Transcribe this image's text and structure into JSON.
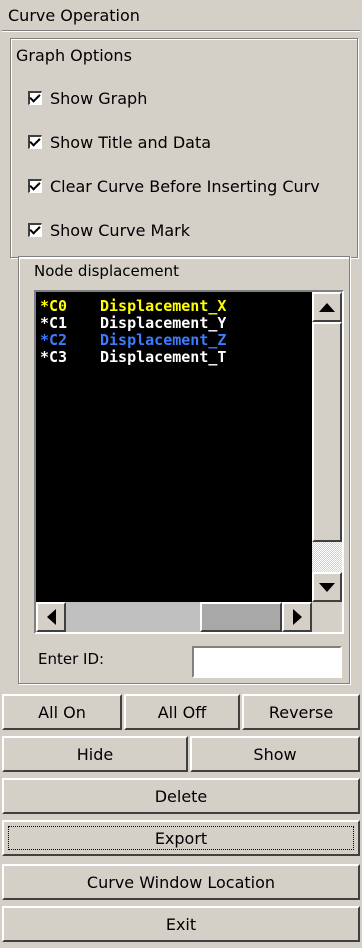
{
  "panel": {
    "title": "Curve Operation"
  },
  "graph_options": {
    "title": "Graph Options",
    "checkboxes": [
      {
        "label": "Show Graph",
        "checked": true
      },
      {
        "label": "Show Title and Data",
        "checked": true
      },
      {
        "label": "Clear Curve Before Inserting Curv",
        "checked": true
      },
      {
        "label": "Show Curve Mark",
        "checked": true
      }
    ]
  },
  "node_group": {
    "title": "Node displacement",
    "list": [
      {
        "id": "*C0",
        "name": "Displacement_X",
        "color": "#ffff00"
      },
      {
        "id": "*C1",
        "name": "Displacement_Y",
        "color": "#ffffff"
      },
      {
        "id": "*C2",
        "name": "Displacement_Z",
        "color": "#3c7cff"
      },
      {
        "id": "*C3",
        "name": "Displacement_T",
        "color": "#ffffff"
      }
    ],
    "enter_id_label": "Enter ID:",
    "enter_id_value": ""
  },
  "buttons": {
    "all_on": "All On",
    "all_off": "All Off",
    "reverse": "Reverse",
    "hide": "Hide",
    "show": "Show",
    "delete": "Delete",
    "export": "Export",
    "curve_window_location": "Curve Window Location",
    "exit": "Exit"
  }
}
